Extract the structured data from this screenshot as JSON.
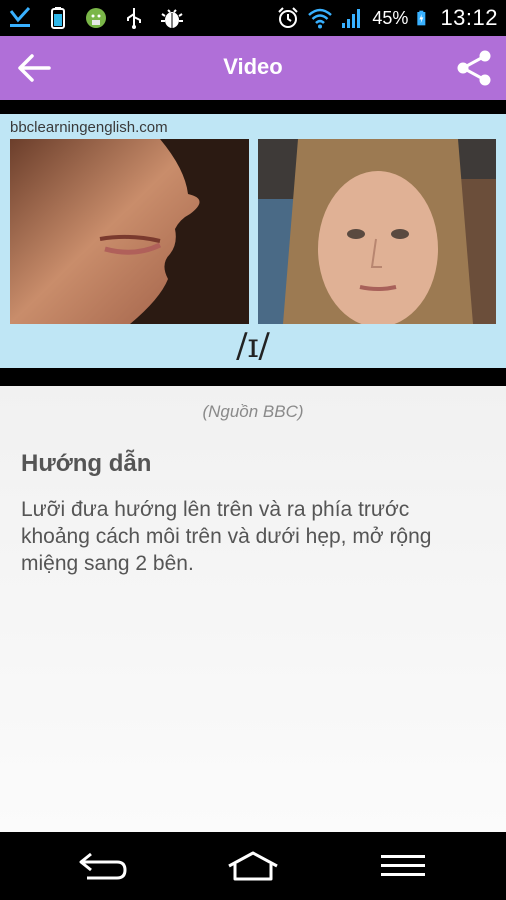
{
  "status_bar": {
    "battery_percent": "45%",
    "time": "13:12",
    "icons": [
      "check-download-icon",
      "usb-battery-icon",
      "android-icon",
      "usb-icon",
      "bug-icon",
      "alarm-icon",
      "wifi-icon",
      "signal-icon",
      "battery-charging-icon"
    ]
  },
  "app_bar": {
    "title": "Video",
    "back_icon": "arrow-left-icon",
    "share_icon": "share-icon",
    "background": "#b06fd8"
  },
  "video": {
    "site_label": "bbclearningenglish.com",
    "phoneme": "/ɪ/"
  },
  "content": {
    "source": "(Nguồn BBC)",
    "heading": "Hướng dẫn",
    "body": "Lưỡi đưa hướng lên trên và ra phía trước khoảng cách môi trên và dưới hẹp, mở rộng miệng sang 2 bên."
  },
  "nav_bar": {
    "back_icon": "nav-back-icon",
    "home_icon": "nav-home-icon",
    "menu_icon": "nav-menu-icon"
  }
}
